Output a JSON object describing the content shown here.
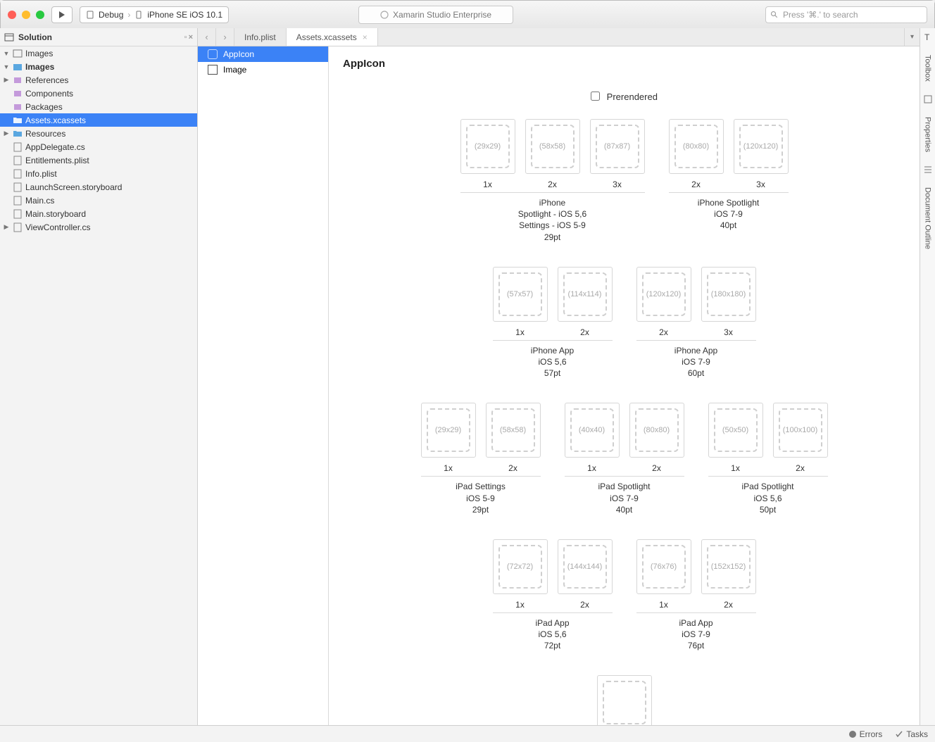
{
  "toolbar": {
    "run_tooltip": "Run",
    "scheme_config": "Debug",
    "scheme_device": "iPhone SE iOS 10.1",
    "window_title": "Xamarin Studio Enterprise",
    "search_placeholder": "Press '⌘.' to search"
  },
  "solution": {
    "title": "Solution",
    "root": "Images",
    "project": "Images",
    "items": {
      "references": "References",
      "components": "Components",
      "packages": "Packages",
      "assets": "Assets.xcassets",
      "resources": "Resources",
      "appdelegate": "AppDelegate.cs",
      "entitlements": "Entitlements.plist",
      "infoplist": "Info.plist",
      "launchscreen": "LaunchScreen.storyboard",
      "maincs": "Main.cs",
      "mainstoryboard": "Main.storyboard",
      "viewcontroller": "ViewController.cs"
    }
  },
  "tabs": {
    "info": "Info.plist",
    "assets": "Assets.xcassets"
  },
  "assetlist": {
    "appicon": "AppIcon",
    "image": "Image"
  },
  "editor": {
    "heading": "AppIcon",
    "prerendered": "Prerendered"
  },
  "right_panels": {
    "toolbox": "Toolbox",
    "properties": "Properties",
    "outline": "Document Outline"
  },
  "status": {
    "errors": "Errors",
    "tasks": "Tasks"
  },
  "icon_groups": [
    {
      "row": 0,
      "groups": [
        {
          "slots": [
            {
              "size": "(29x29)",
              "scale": "1x"
            },
            {
              "size": "(58x58)",
              "scale": "2x"
            },
            {
              "size": "(87x87)",
              "scale": "3x"
            }
          ],
          "desc": "iPhone\nSpotlight - iOS 5,6\nSettings - iOS 5-9\n29pt"
        },
        {
          "slots": [
            {
              "size": "(80x80)",
              "scale": "2x"
            },
            {
              "size": "(120x120)",
              "scale": "3x"
            }
          ],
          "desc": "iPhone Spotlight\niOS 7-9\n40pt"
        }
      ]
    },
    {
      "row": 1,
      "groups": [
        {
          "slots": [
            {
              "size": "(57x57)",
              "scale": "1x"
            },
            {
              "size": "(114x114)",
              "scale": "2x"
            }
          ],
          "desc": "iPhone App\niOS 5,6\n57pt"
        },
        {
          "slots": [
            {
              "size": "(120x120)",
              "scale": "2x"
            },
            {
              "size": "(180x180)",
              "scale": "3x"
            }
          ],
          "desc": "iPhone App\niOS 7-9\n60pt"
        }
      ]
    },
    {
      "row": 2,
      "groups": [
        {
          "slots": [
            {
              "size": "(29x29)",
              "scale": "1x"
            },
            {
              "size": "(58x58)",
              "scale": "2x"
            }
          ],
          "desc": "iPad Settings\niOS 5-9\n29pt"
        },
        {
          "slots": [
            {
              "size": "(40x40)",
              "scale": "1x"
            },
            {
              "size": "(80x80)",
              "scale": "2x"
            }
          ],
          "desc": "iPad Spotlight\niOS 7-9\n40pt"
        },
        {
          "slots": [
            {
              "size": "(50x50)",
              "scale": "1x"
            },
            {
              "size": "(100x100)",
              "scale": "2x"
            }
          ],
          "desc": "iPad Spotlight\niOS 5,6\n50pt"
        }
      ]
    },
    {
      "row": 3,
      "groups": [
        {
          "slots": [
            {
              "size": "(72x72)",
              "scale": "1x"
            },
            {
              "size": "(144x144)",
              "scale": "2x"
            }
          ],
          "desc": "iPad App\niOS 5,6\n72pt"
        },
        {
          "slots": [
            {
              "size": "(76x76)",
              "scale": "1x"
            },
            {
              "size": "(152x152)",
              "scale": "2x"
            }
          ],
          "desc": "iPad App\niOS 7-9\n76pt"
        }
      ]
    },
    {
      "row": 4,
      "groups": [
        {
          "slots": [
            {
              "size": "",
              "scale": ""
            }
          ],
          "desc": ""
        }
      ]
    }
  ]
}
